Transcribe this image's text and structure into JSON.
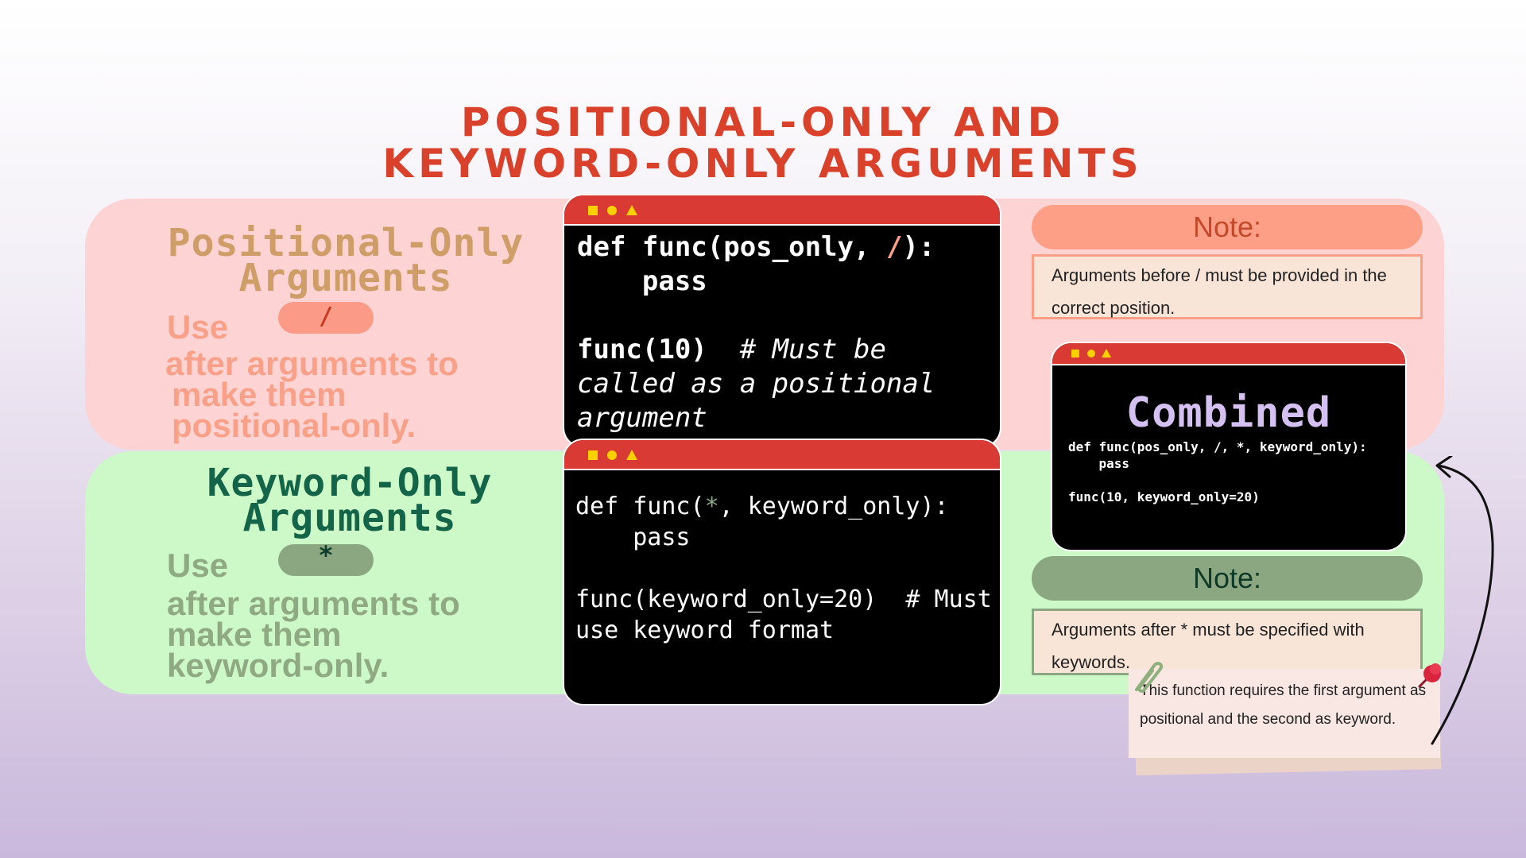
{
  "title": {
    "line1": "Positional-Only and",
    "line2": "Keyword-Only Arguments"
  },
  "positional": {
    "heading_line1": "Positional-Only",
    "heading_line2": "Arguments",
    "use_label": "Use",
    "pill_symbol": "/",
    "desc_line1": "after arguments to",
    "desc_line2": "make them",
    "desc_line3": "positional-only.",
    "code": {
      "l1_pre": "def func(pos_only, ",
      "l1_slash": "/",
      "l1_post": "):",
      "l2": "    pass",
      "l3_code": "func(10)",
      "l3_comment": "  # Must be",
      "l4": "called as a positional",
      "l5": "argument"
    }
  },
  "keyword": {
    "heading_line1": "Keyword-Only",
    "heading_line2": "Arguments",
    "use_label": "Use",
    "pill_symbol": "*",
    "desc_line1": "after arguments to",
    "desc_line2": "make them",
    "desc_line3": "keyword-only.",
    "code": {
      "l1_pre": "def func(",
      "l1_star": "*",
      "l1_post": ", keyword_only):",
      "l2": "    pass",
      "l3": "func(keyword_only=20)  # Must",
      "l4": "use keyword format"
    }
  },
  "combined": {
    "heading": "Combined",
    "l1": "def func(pos_only, /, *, keyword_only):",
    "l2": "    pass",
    "l3": "func(10, keyword_only=20)"
  },
  "note1": {
    "label": "Note:",
    "line1": "Arguments before / must be provided in the",
    "line2": "correct position."
  },
  "note2": {
    "label": "Note:",
    "line1": "Arguments after * must be specified with",
    "line2": "keywords."
  },
  "sticky": {
    "line1": "This function requires the first argument as",
    "line2": "positional and the second as keyword."
  },
  "icons": [
    "square-dot-icon",
    "circle-dot-icon",
    "triangle-dot-icon",
    "pushpin-icon",
    "paperclip-icon",
    "curved-arrow-icon"
  ],
  "colors": {
    "title": "#d9412b",
    "pink_band": "#fdd3d3",
    "green_band": "#ccf9c7",
    "window_bar": "#d93a33",
    "window_bg": "#000000",
    "combined_heading": "#d4c1f1"
  }
}
